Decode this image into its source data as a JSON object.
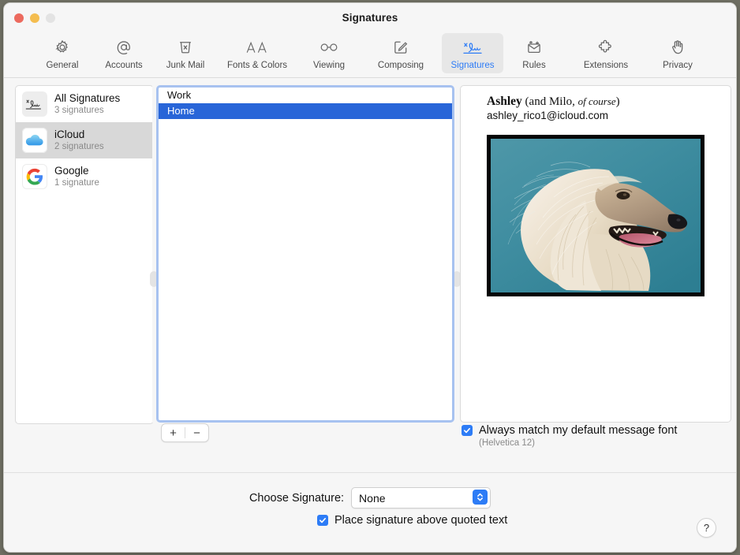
{
  "window": {
    "title": "Signatures",
    "traffic_lights": [
      "close",
      "minimize",
      "zoom"
    ]
  },
  "toolbar": {
    "items": [
      {
        "label": "General",
        "icon": "gear-icon",
        "selected": false
      },
      {
        "label": "Accounts",
        "icon": "at-sign-icon",
        "selected": false
      },
      {
        "label": "Junk Mail",
        "icon": "trash-x-icon",
        "selected": false
      },
      {
        "label": "Fonts & Colors",
        "icon": "aa-text-icon",
        "selected": false
      },
      {
        "label": "Viewing",
        "icon": "glasses-icon",
        "selected": false
      },
      {
        "label": "Composing",
        "icon": "compose-pencil-icon",
        "selected": false
      },
      {
        "label": "Signatures",
        "icon": "signature-icon",
        "selected": true
      },
      {
        "label": "Rules",
        "icon": "envelope-arrows-icon",
        "selected": false
      },
      {
        "label": "Extensions",
        "icon": "puzzle-piece-icon",
        "selected": false
      },
      {
        "label": "Privacy",
        "icon": "hand-raised-icon",
        "selected": false
      }
    ]
  },
  "sidebar": {
    "accounts": [
      {
        "name": "All Signatures",
        "count_label": "3 signatures",
        "icon": "signature-icon",
        "selected": false
      },
      {
        "name": "iCloud",
        "count_label": "2 signatures",
        "icon": "icloud-icon",
        "selected": true
      },
      {
        "name": "Google",
        "count_label": "1 signature",
        "icon": "google-icon",
        "selected": false
      }
    ]
  },
  "signature_list": {
    "items": [
      {
        "name": "Work",
        "selected": false
      },
      {
        "name": "Home",
        "selected": true
      }
    ],
    "add_label": "+",
    "remove_label": "−"
  },
  "preview": {
    "name_bold": "Ashley",
    "name_rest": " (and Milo, ",
    "name_italic": "of course",
    "name_close": ")",
    "email": "ashley_rico1@icloud.com",
    "photo_alt": "afghan-hound-photo"
  },
  "options": {
    "match_font_label": "Always match my default message font",
    "match_font_sub": "(Helvetica 12)",
    "match_font_checked": true,
    "choose_signature_label": "Choose Signature:",
    "choose_signature_value": "None",
    "place_above_label": "Place signature above quoted text",
    "place_above_checked": true,
    "help_label": "?"
  },
  "colors": {
    "accent": "#2d7cf6",
    "selection_blue": "#2865d8",
    "focus_ring": "#a7c2f0",
    "window_bg": "#f6f6f6",
    "photo_bg": "#3d8fa0"
  }
}
